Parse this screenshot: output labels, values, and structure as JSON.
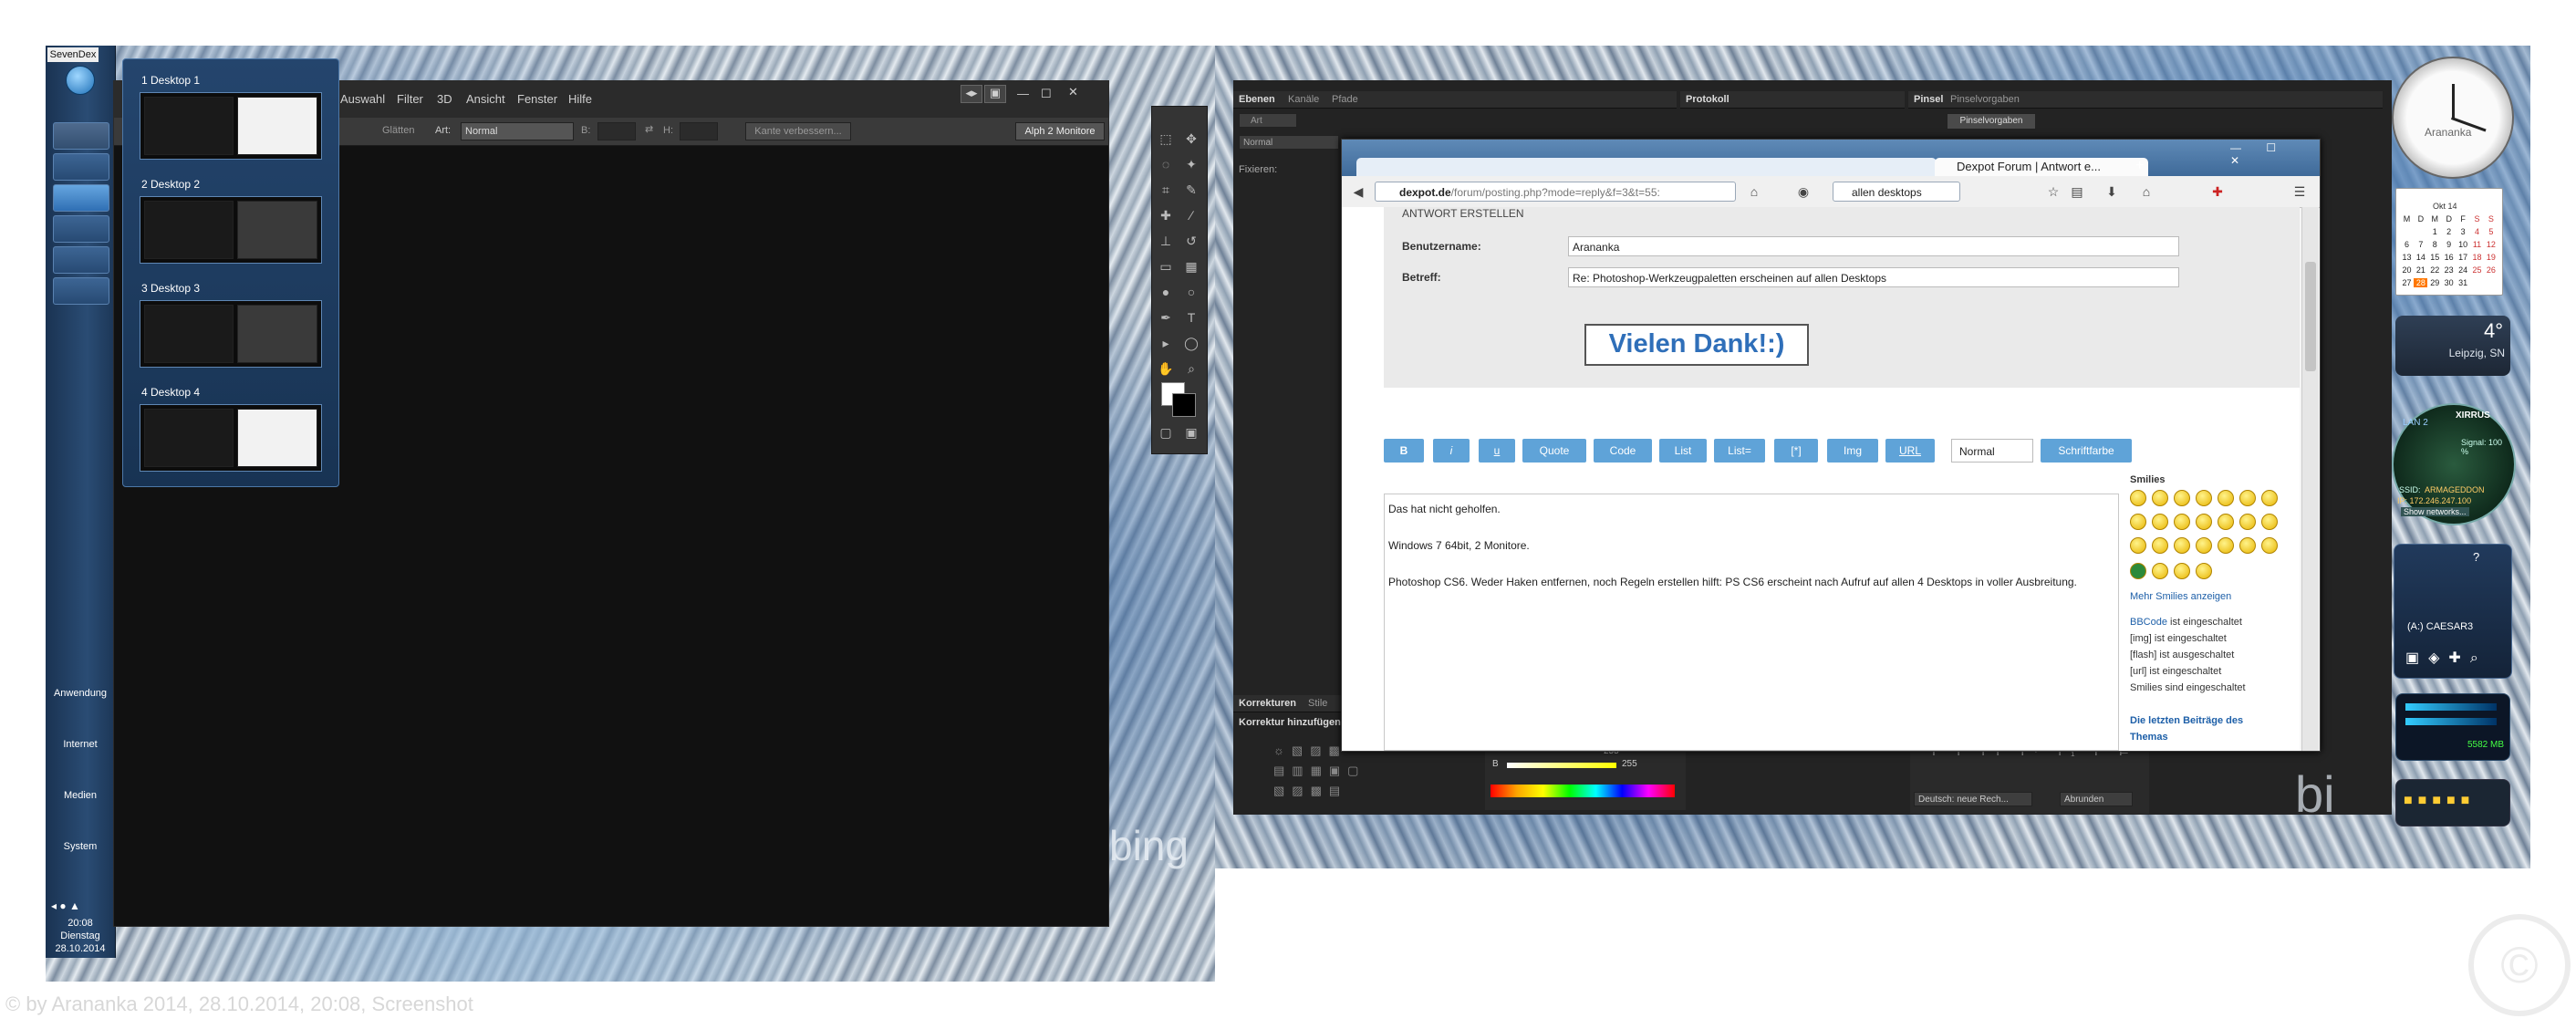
{
  "taskbar": {
    "start_label": "SevenDex",
    "groups": [
      "Anwendung",
      "Internet",
      "Medien",
      "System"
    ],
    "clock": {
      "time": "20:08",
      "day": "Dienstag",
      "date": "28.10.2014"
    }
  },
  "desktops": [
    {
      "label": "1  Desktop 1"
    },
    {
      "label": "2  Desktop 2"
    },
    {
      "label": "3  Desktop 3"
    },
    {
      "label": "4  Desktop 4"
    }
  ],
  "photoshop_left": {
    "menu": [
      "Auswahl",
      "Filter",
      "3D",
      "Ansicht",
      "Fenster",
      "Hilfe"
    ],
    "options": {
      "glaetten": "Glätten",
      "art_label": "Art:",
      "art_value": "Normal",
      "b_label": "B:",
      "h_label": "H:",
      "refine_button": "Kante verbessern...",
      "workspace": "Alph 2 Monitore"
    }
  },
  "wallpaper_text": "bing",
  "photoshop_right": {
    "panel_tabs_1": [
      "Ebenen",
      "Kanäle",
      "Pfade"
    ],
    "panel_tab_2": "Protokoll",
    "panel_tabs_3": [
      "Pinsel",
      "Pinselvorgaben"
    ],
    "brush_button": "Pinselvorgaben",
    "layer_mode": "Normal",
    "fix_label": "Fixieren:",
    "kind_label": "Art",
    "corrections_tabs": [
      "Korrekturen",
      "Stile"
    ],
    "corrections_title": "Korrektur hinzufügen",
    "slider_values": [
      "255",
      "255"
    ],
    "slider_label_b": "B",
    "lang": "Deutsch: neue Rech...",
    "round": "Abrunden"
  },
  "firefox": {
    "tabs": [
      {
        "title": ""
      },
      {
        "title": ""
      },
      {
        "title": ""
      },
      {
        "title": "Dexpot Forum | Antwort e..."
      }
    ],
    "url_domain": "dexpot.de",
    "url_path": "/forum/posting.php?mode=reply&f=3&t=55:",
    "search_value": "allen desktops",
    "form_header": "ANTWORT ERSTELLEN",
    "username_label": "Benutzername:",
    "username_value": "Arananka",
    "subject_label": "Betreff:",
    "subject_value": "Re: Photoshop-Werkzeugpaletten erscheinen auf allen Desktops",
    "thanks_text": "Vielen Dank!:)",
    "bbcode_buttons": [
      "B",
      "i",
      "u",
      "Quote",
      "Code",
      "List",
      "List=",
      "[*]",
      "Img",
      "URL"
    ],
    "font_size_select": "Normal",
    "font_color_button": "Schriftfarbe",
    "message_lines": [
      "Das hat nicht geholfen.",
      "Windows 7 64bit, 2 Monitore.",
      "Photoshop CS6. Weder  Haken entfernen, noch Regeln erstellen hilft: PS CS6 erscheint nach Aufruf auf allen 4 Desktops in voller Ausbreitung."
    ],
    "smilies_title": "Smilies",
    "more_smilies": "Mehr Smilies anzeigen",
    "rules": [
      {
        "link": "BBCode",
        "text": " ist eingeschaltet"
      },
      {
        "link": "",
        "text": "[img] ist eingeschaltet"
      },
      {
        "link": "",
        "text": "[flash] ist ausgeschaltet"
      },
      {
        "link": "",
        "text": "[url] ist eingeschaltet"
      },
      {
        "link": "",
        "text": "Smilies sind eingeschaltet"
      }
    ],
    "latest_posts": "Die letzten Beiträge des Themas"
  },
  "gadgets": {
    "clock_label": "Arananka",
    "calendar_month": "Okt 14",
    "calendar_head": [
      "M",
      "D",
      "M",
      "D",
      "F",
      "S",
      "S"
    ],
    "calendar_rows": [
      [
        "",
        "",
        "1",
        "2",
        "3",
        "4",
        "5"
      ],
      [
        "6",
        "7",
        "8",
        "9",
        "10",
        "11",
        "12"
      ],
      [
        "13",
        "14",
        "15",
        "16",
        "17",
        "18",
        "19"
      ],
      [
        "20",
        "21",
        "22",
        "23",
        "24",
        "25",
        "26"
      ],
      [
        "27",
        "28",
        "29",
        "30",
        "31",
        "",
        ""
      ]
    ],
    "weather_temp": "4°",
    "weather_city": "Leipzig, SN",
    "wifi_brand": "XIRRUS",
    "wifi_signal": "Signal: 100 %",
    "wifi_ssid_label": "SSID:",
    "wifi_ssid": "ARMAGEDDON",
    "wifi_ip": "IP: 172.246.247.100",
    "wifi_button": "Show networks...",
    "wifi_lan": "LAN 2",
    "user_label": "(A:) CAESAR3",
    "memory": "5582 MB",
    "bing_text": "bi"
  },
  "watermark": "© by Arananka 2014, 28.10.2014, 20:08, Screenshot"
}
